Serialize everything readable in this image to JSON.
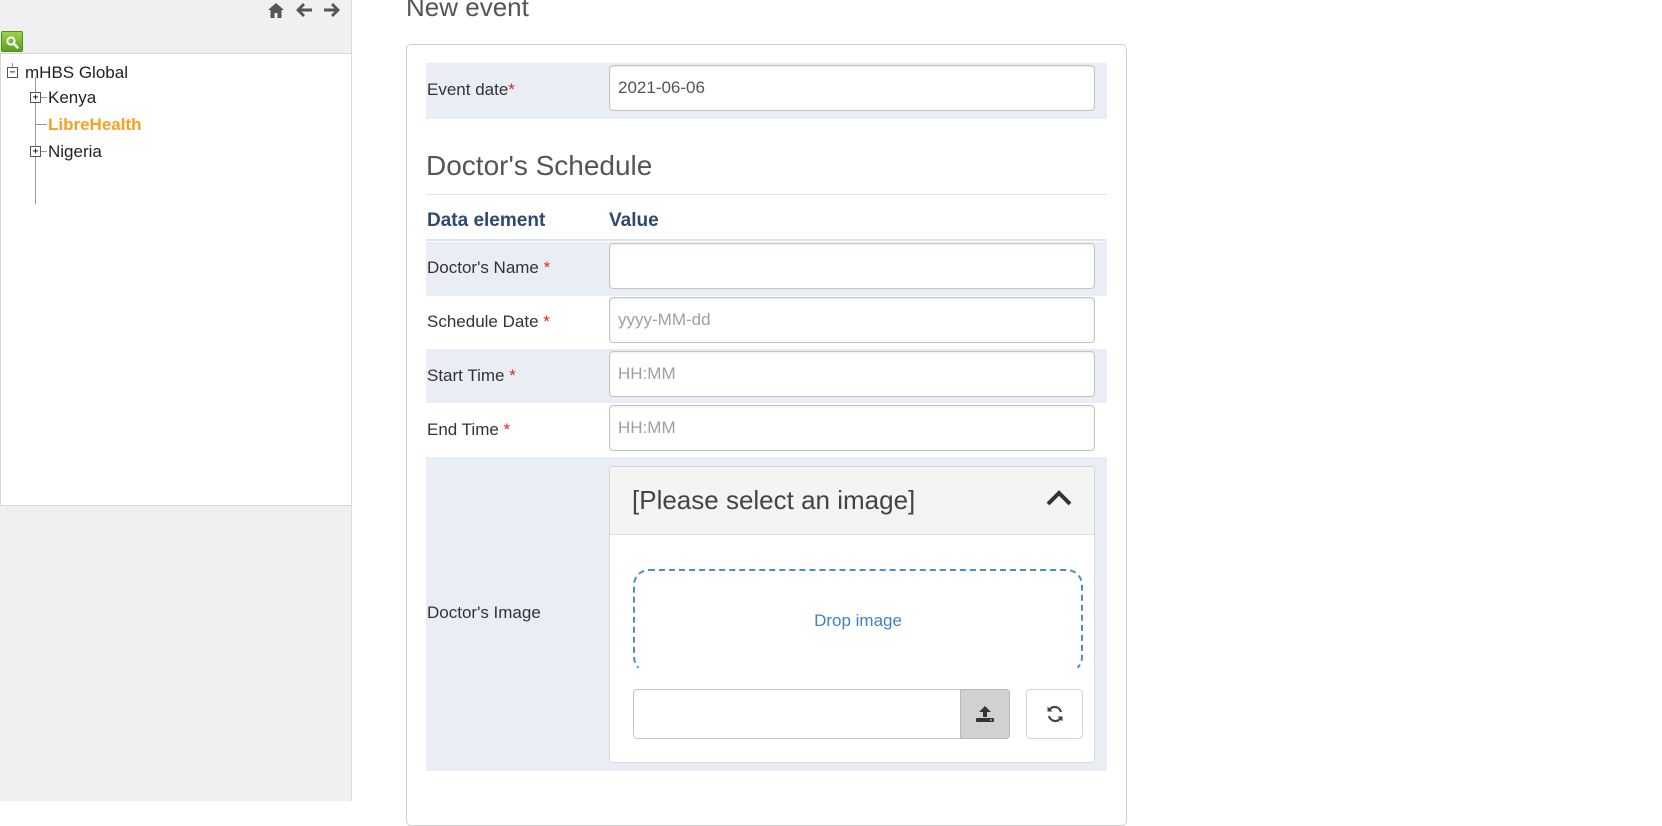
{
  "tree": {
    "root": {
      "label": "mHBS Global",
      "toggle": "−"
    },
    "children": [
      {
        "label": "Kenya",
        "toggle": "+"
      },
      {
        "label": "LibreHealth",
        "selected": true
      },
      {
        "label": "Nigeria",
        "toggle": "+"
      }
    ]
  },
  "nav": {
    "icons": [
      "home-icon",
      "arrow-left-icon",
      "arrow-right-icon"
    ],
    "search_icon": "search-icon"
  },
  "page": {
    "title": "New event"
  },
  "event_date": {
    "label": "Event date",
    "required_mark": "*",
    "value": "2021-06-06"
  },
  "section": {
    "title": "Doctor's Schedule",
    "col_data_element": "Data element",
    "col_value": "Value"
  },
  "fields": {
    "doctor_name": {
      "label": "Doctor's Name ",
      "required_mark": "*",
      "value": "",
      "placeholder": ""
    },
    "schedule_date": {
      "label": "Schedule Date ",
      "required_mark": "*",
      "value": "",
      "placeholder": "yyyy-MM-dd"
    },
    "start_time": {
      "label": "Start Time ",
      "required_mark": "*",
      "value": "",
      "placeholder": "HH:MM"
    },
    "end_time": {
      "label": "End Time ",
      "required_mark": "*",
      "value": "",
      "placeholder": "HH:MM"
    },
    "doctor_image": {
      "label": "Doctor's Image",
      "panel_title": "[Please select an image]",
      "drop_text": "Drop image"
    }
  },
  "colors": {
    "selected_node": "#f7a11e",
    "required": "#e0291b",
    "header_text": "#2d4a6e",
    "row_highlight": "#e9eef5",
    "link": "#3f82c3"
  }
}
